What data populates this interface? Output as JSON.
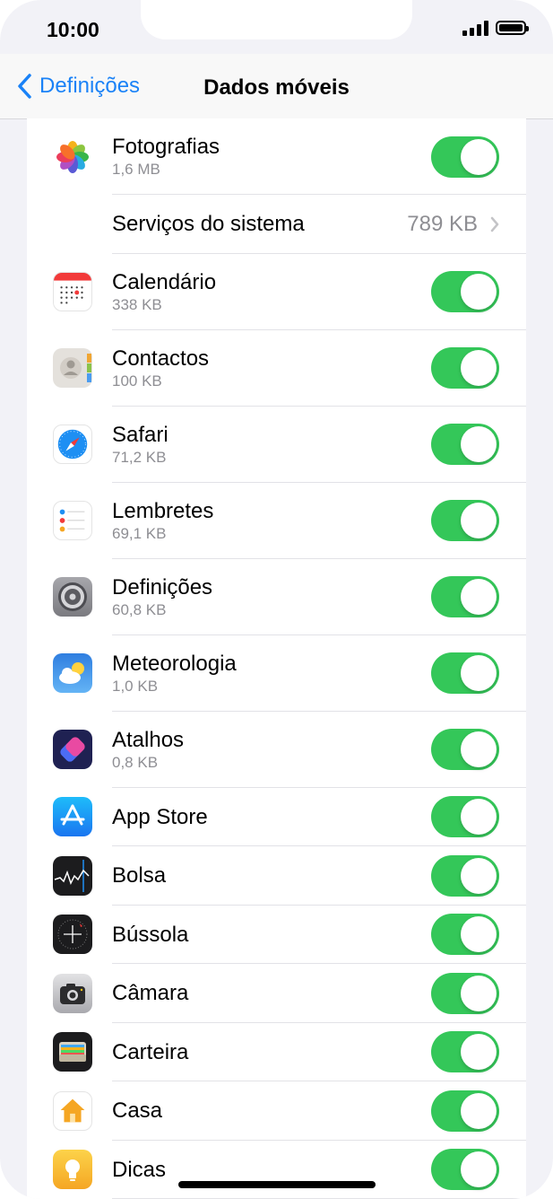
{
  "status": {
    "time": "10:00"
  },
  "nav": {
    "back_label": "Definições",
    "title": "Dados móveis"
  },
  "system_services": {
    "label": "Serviços do sistema",
    "value": "789 KB"
  },
  "apps": [
    {
      "name": "Fotografias",
      "usage": "1,6 MB",
      "icon": "photos-icon",
      "enabled": true
    },
    {
      "name": "Calendário",
      "usage": "338 KB",
      "icon": "calendar-icon",
      "enabled": true
    },
    {
      "name": "Contactos",
      "usage": "100 KB",
      "icon": "contacts-icon",
      "enabled": true
    },
    {
      "name": "Safari",
      "usage": "71,2 KB",
      "icon": "safari-icon",
      "enabled": true
    },
    {
      "name": "Lembretes",
      "usage": "69,1 KB",
      "icon": "reminders-icon",
      "enabled": true
    },
    {
      "name": "Definições",
      "usage": "60,8 KB",
      "icon": "settings-gear-icon",
      "enabled": true
    },
    {
      "name": "Meteorologia",
      "usage": "1,0 KB",
      "icon": "weather-icon",
      "enabled": true
    },
    {
      "name": "Atalhos",
      "usage": "0,8 KB",
      "icon": "shortcuts-icon",
      "enabled": true
    },
    {
      "name": "App Store",
      "icon": "app-store-icon",
      "enabled": true
    },
    {
      "name": "Bolsa",
      "icon": "stocks-icon",
      "enabled": true
    },
    {
      "name": "Bússola",
      "icon": "compass-icon",
      "enabled": true
    },
    {
      "name": "Câmara",
      "icon": "camera-icon",
      "enabled": true
    },
    {
      "name": "Carteira",
      "icon": "wallet-icon",
      "enabled": true
    },
    {
      "name": "Casa",
      "icon": "home-icon",
      "enabled": true
    },
    {
      "name": "Dicas",
      "icon": "tips-icon",
      "enabled": true
    }
  ],
  "colors": {
    "accent": "#1a82f7",
    "toggle_on": "#34c759",
    "secondary_text": "#8e8e93"
  }
}
